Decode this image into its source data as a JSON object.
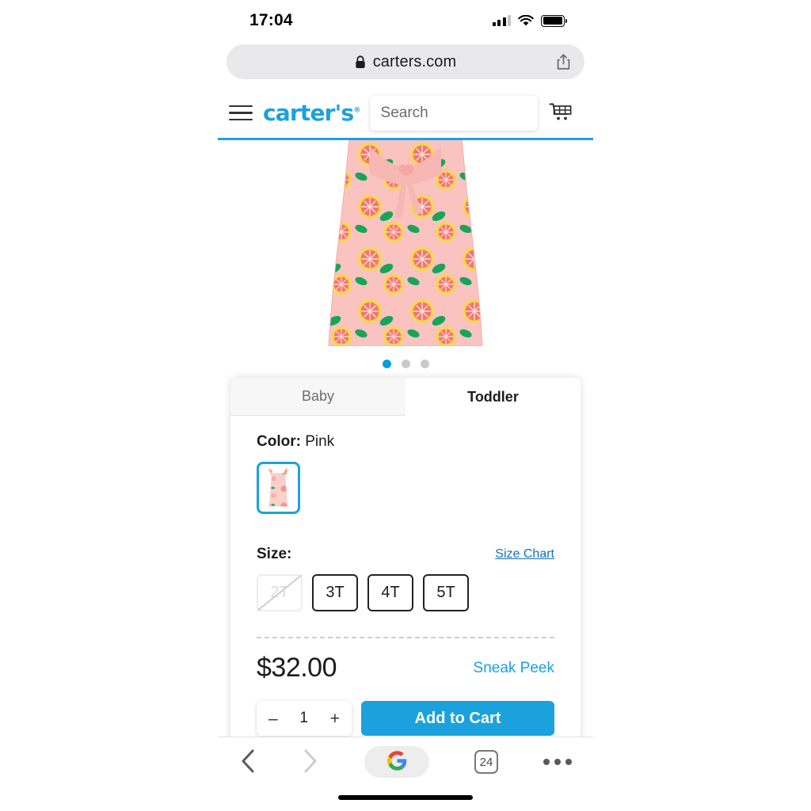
{
  "status_bar": {
    "time": "17:04",
    "signal_icon": "cellular-signal-icon",
    "wifi_icon": "wifi-icon",
    "battery_icon": "battery-full-icon"
  },
  "url_bar": {
    "lock_icon": "lock-icon",
    "host": "carters.com",
    "share_icon": "share-icon"
  },
  "site_header": {
    "menu_icon": "hamburger-menu-icon",
    "brand": "carter's",
    "brand_trademark": "®",
    "search_placeholder": "Search",
    "search_value": "",
    "search_icon": "search-icon",
    "cart_icon": "shopping-cart-icon"
  },
  "gallery": {
    "product_image_alt": "pink grapefruit print toddler dress",
    "dots": [
      {
        "active": true
      },
      {
        "active": false
      },
      {
        "active": false
      }
    ]
  },
  "product": {
    "tabs": [
      {
        "label": "Baby",
        "active": false
      },
      {
        "label": "Toddler",
        "active": true
      }
    ],
    "color_label": "Color:",
    "color_value": "Pink",
    "swatches": [
      {
        "name": "Pink",
        "selected": true
      }
    ],
    "size_label": "Size:",
    "size_chart_link": "Size Chart",
    "sizes": [
      {
        "label": "2T",
        "disabled": true,
        "selected": false
      },
      {
        "label": "3T",
        "disabled": false,
        "selected": false
      },
      {
        "label": "4T",
        "disabled": false,
        "selected": false
      },
      {
        "label": "5T",
        "disabled": false,
        "selected": false
      }
    ],
    "price": "$32.00",
    "sneak_peek": "Sneak Peek",
    "quantity": "1",
    "decrement_label": "–",
    "increment_label": "+",
    "add_to_cart_label": "Add to Cart"
  },
  "browser_toolbar": {
    "back_icon": "chevron-left-icon",
    "forward_icon": "chevron-right-icon",
    "search_engine_icon": "google-logo-icon",
    "tab_count": "24",
    "more_icon": "more-options-icon"
  },
  "colors": {
    "brand_blue": "#1ba2dc",
    "link_blue": "#1273b5",
    "dot_active": "#00a0e0"
  }
}
